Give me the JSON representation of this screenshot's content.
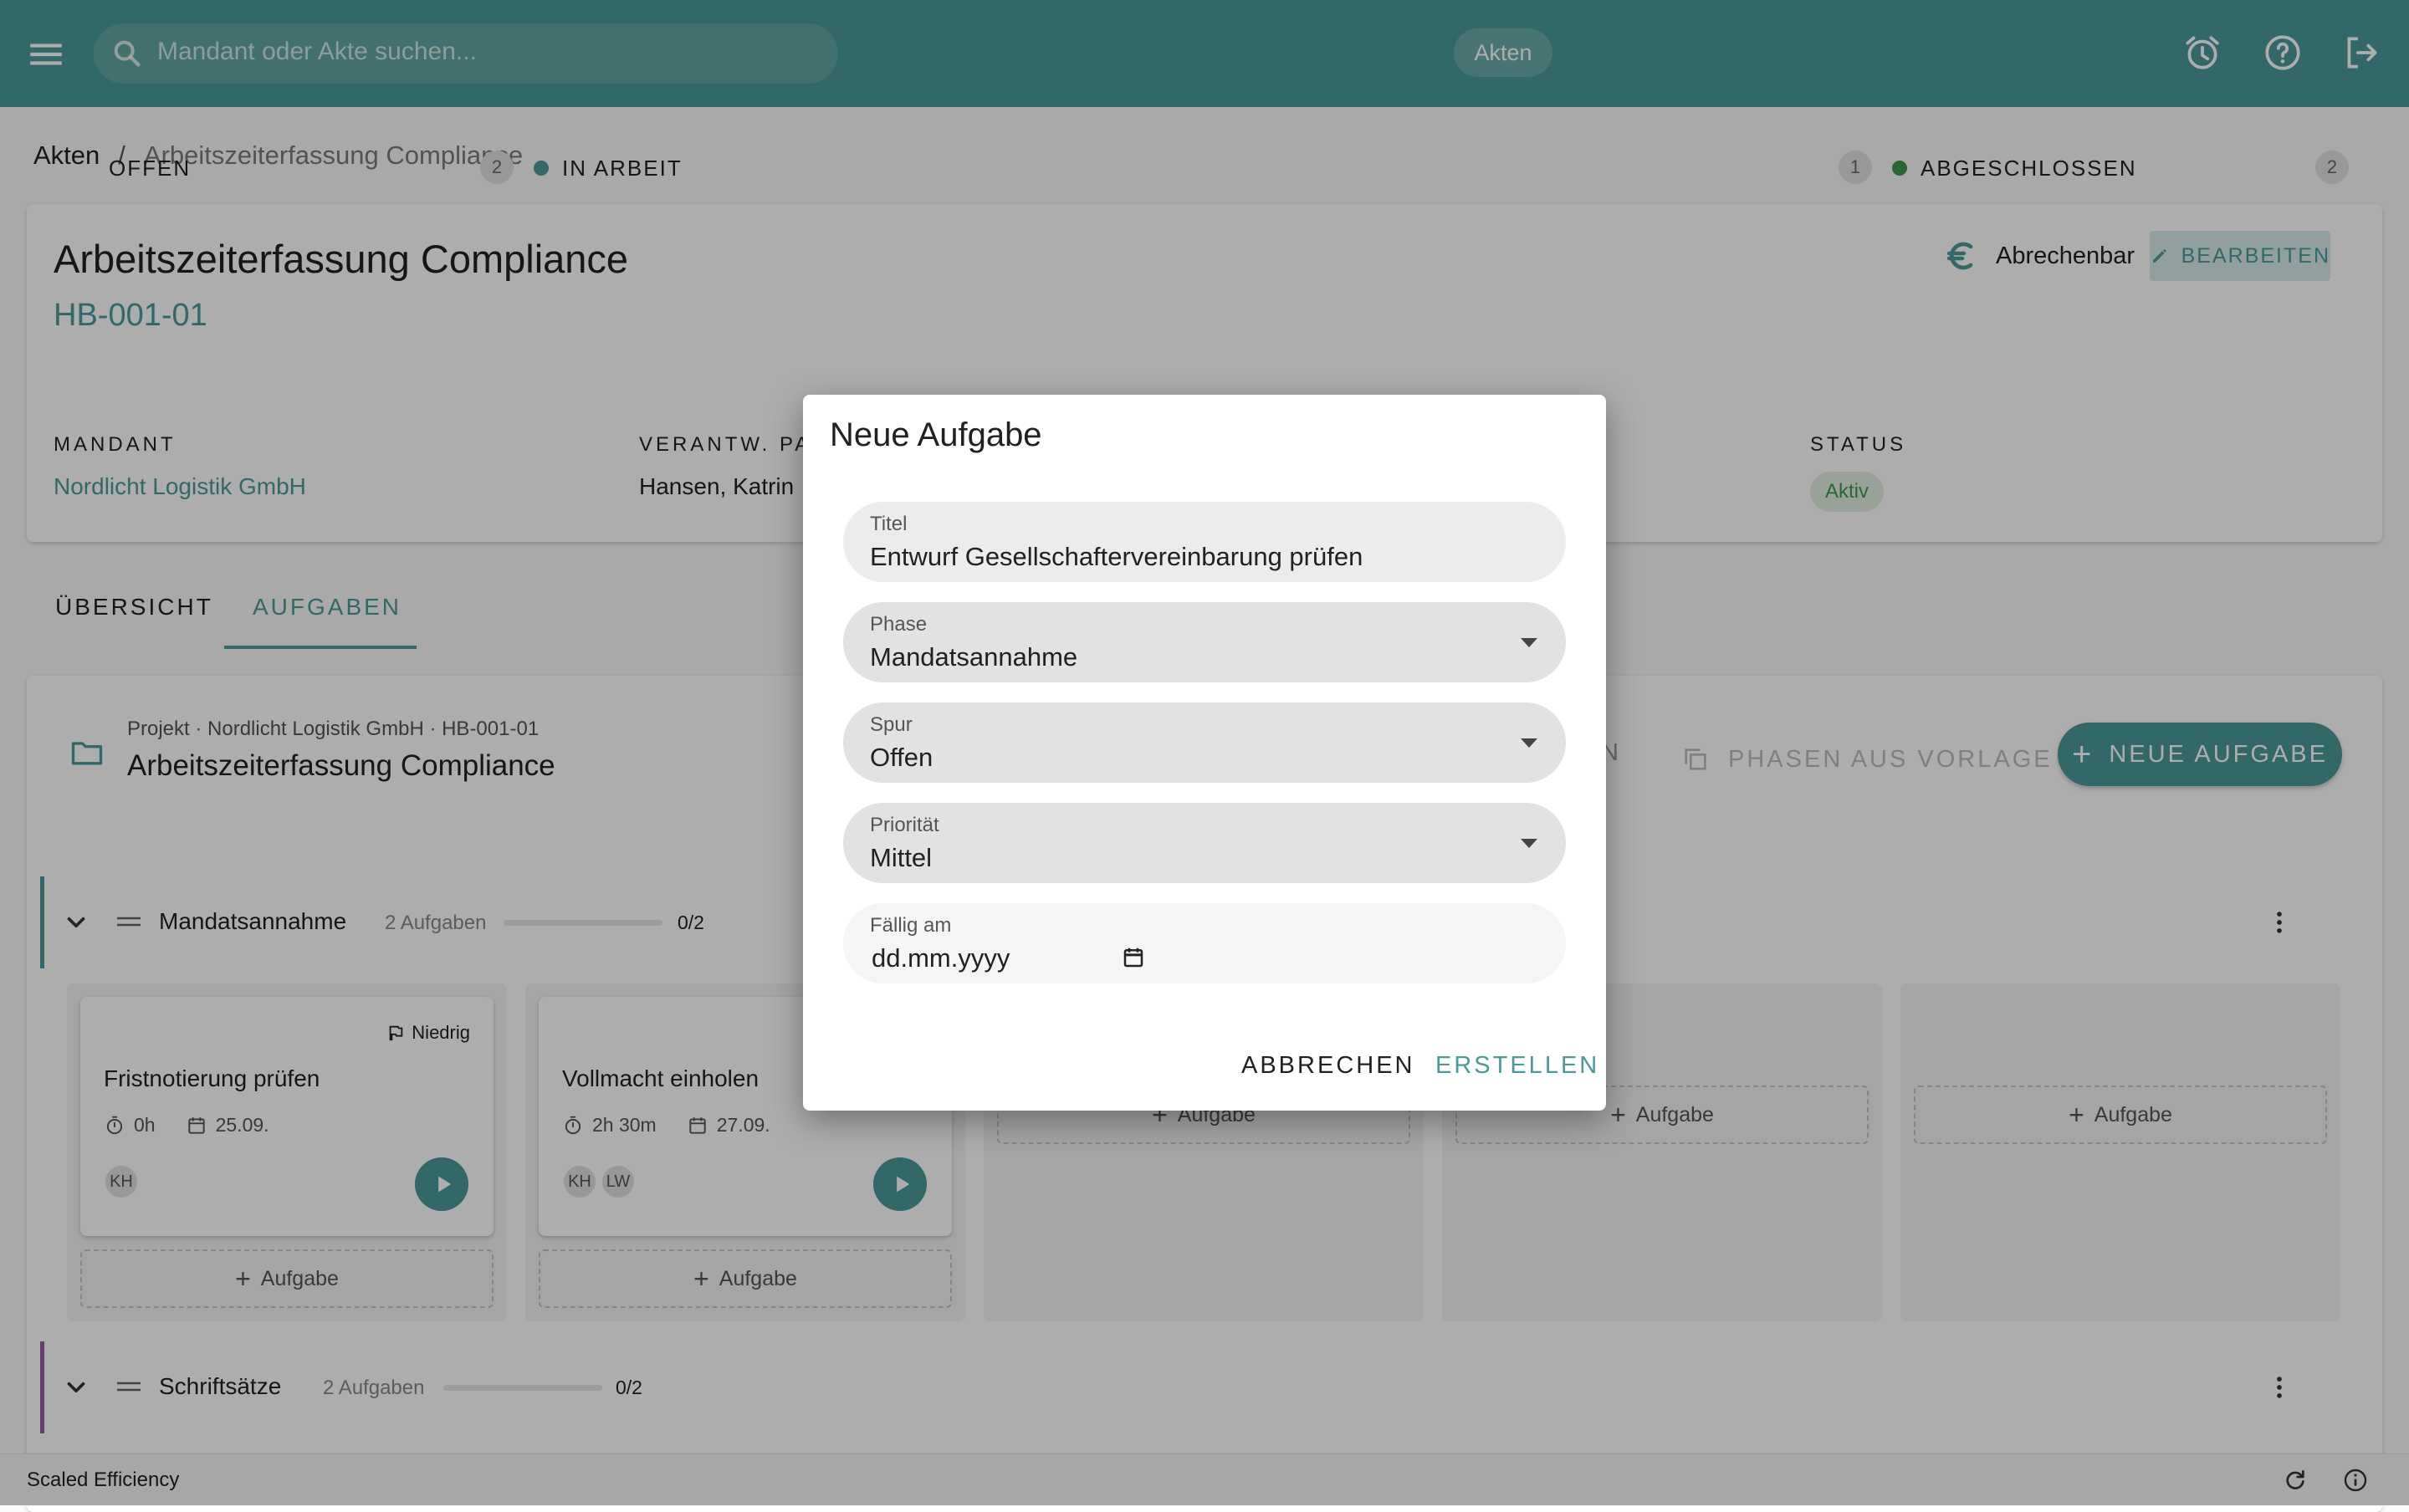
{
  "appbar": {
    "search_placeholder": "Mandant oder Akte suchen...",
    "chip": "Akten",
    "icons": [
      "menu-icon",
      "search-icon",
      "alarm-icon",
      "help-icon",
      "logout-icon"
    ]
  },
  "breadcrumb": {
    "root": "Akten",
    "separator": "/",
    "current": "Arbeitszeiterfassung Compliance"
  },
  "header": {
    "title": "Arbeitszeiterfassung Compliance",
    "code": "HB-001-01",
    "billable_label": "Abrechenbar",
    "edit_label": "BEARBEITEN",
    "mandant_label": "MANDANT",
    "mandant_value": "Nordlicht Logistik GmbH",
    "partner_label": "VERANTW. PA",
    "partner_value": "Hansen, Katrin",
    "status_label": "STATUS",
    "status_value": "Aktiv"
  },
  "tabs": [
    {
      "label": "ÜBERSICHT",
      "active": false
    },
    {
      "label": "AUFGABEN",
      "active": true
    }
  ],
  "board": {
    "subtitle": "Projekt · Nordlicht Logistik GmbH · HB-001-01",
    "title": "Arbeitszeiterfassung Compliance",
    "partial_label": "N",
    "from_template_label": "PHASEN AUS VORLAGE",
    "new_task_label": "NEUE AUFGABE",
    "columns": [
      {
        "label": "OFFEN",
        "count": "2"
      },
      {
        "label": "IN ARBEIT",
        "count": "",
        "dot_color": "#4a9a98"
      },
      {
        "label": "",
        "count": "1"
      },
      {
        "label": "ABGESCHLOSSEN",
        "count": "2",
        "dot_color": "#3a9a4a"
      }
    ],
    "phases": [
      {
        "name": "Mandatsannahme",
        "count_text": "2 Aufgaben",
        "progress_text": "0/2",
        "progress": 0,
        "color": "#4a9a98"
      },
      {
        "name": "Schriftsätze",
        "count_text": "2 Aufgaben",
        "progress_text": "0/2",
        "progress": 0,
        "color": "#9a5aa6"
      }
    ],
    "cards": [
      {
        "priority": "Niedrig",
        "title": "Fristnotierung prüfen",
        "time": "0h",
        "date": "25.09.",
        "assignees": [
          "KH"
        ]
      },
      {
        "priority": "",
        "title": "Vollmacht einholen",
        "time": "2h 30m",
        "date": "27.09.",
        "assignees": [
          "KH",
          "LW"
        ]
      }
    ],
    "add_task_label": "Aufgabe"
  },
  "footer": {
    "text": "Scaled Efficiency"
  },
  "dialog": {
    "title": "Neue Aufgabe",
    "fields": {
      "titel": {
        "label": "Titel",
        "value": "Entwurf Gesellschaftervereinbarung prüfen"
      },
      "phase": {
        "label": "Phase",
        "value": "Mandatsannahme"
      },
      "spur": {
        "label": "Spur",
        "value": "Offen"
      },
      "prioritaet": {
        "label": "Priorität",
        "value": "Mittel"
      },
      "faellig": {
        "label": "Fällig am",
        "placeholder": "dd.mm.yyyy"
      }
    },
    "cancel_label": "ABBRECHEN",
    "create_label": "ERSTELLEN"
  },
  "colors": {
    "primary": "#4a9a98",
    "success": "#3a9a4a",
    "phase2": "#9a5aa6"
  }
}
